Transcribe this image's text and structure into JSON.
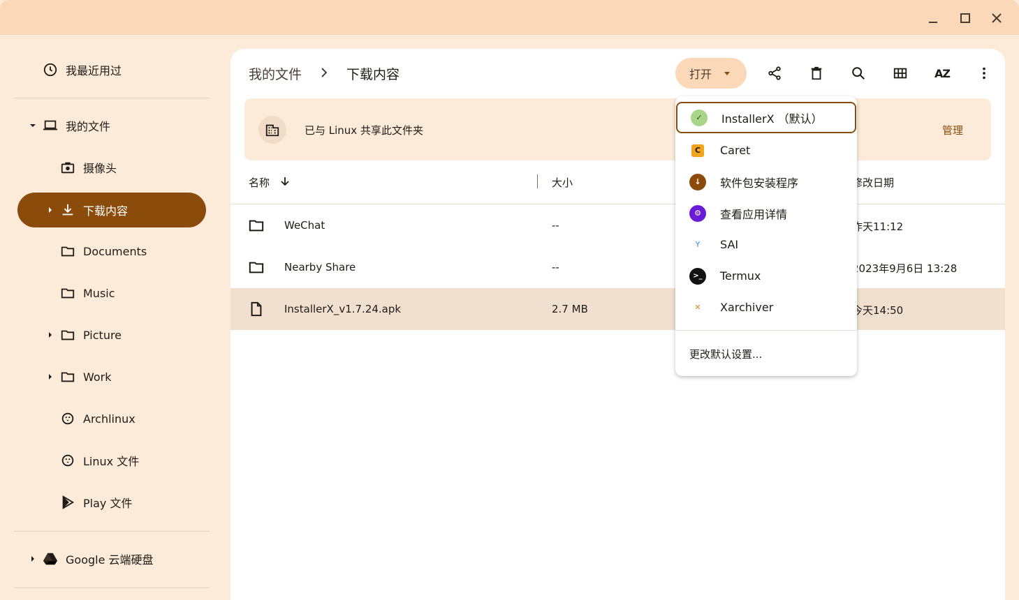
{
  "window": {
    "minimize_icon": "minimize-icon",
    "maximize_icon": "maximize-icon",
    "close_icon": "close-icon"
  },
  "sidebar": {
    "recent": "我最近用过",
    "my_files": "我的文件",
    "items": [
      {
        "label": "摄像头",
        "icon": "camera-icon"
      },
      {
        "label": "下载内容",
        "icon": "download-icon"
      },
      {
        "label": "Documents",
        "icon": "folder-icon"
      },
      {
        "label": "Music",
        "icon": "folder-icon"
      },
      {
        "label": "Picture",
        "icon": "folder-icon"
      },
      {
        "label": "Work",
        "icon": "folder-icon"
      },
      {
        "label": "Archlinux",
        "icon": "penguin-icon"
      },
      {
        "label": "Linux 文件",
        "icon": "penguin-icon"
      },
      {
        "label": "Play 文件",
        "icon": "play-icon"
      }
    ],
    "drive": "Google 云端硬盘"
  },
  "breadcrumb": {
    "root": "我的文件",
    "current": "下载内容"
  },
  "toolbar": {
    "open_label": "打开",
    "sort_label": "AZ"
  },
  "banner": {
    "text": "已与 Linux 共享此文件夹",
    "manage": "管理"
  },
  "columns": {
    "name": "名称",
    "size": "大小",
    "modified": "修改日期"
  },
  "files": [
    {
      "name": "WeChat",
      "size": "--",
      "date": "昨天11:12",
      "type": "folder"
    },
    {
      "name": "Nearby Share",
      "size": "--",
      "date": "2023年9月6日 13:28",
      "type": "folder"
    },
    {
      "name": "InstallerX_v1.7.24.apk",
      "size": "2.7 MB",
      "date": "今天14:50",
      "type": "file"
    }
  ],
  "open_menu": {
    "apps": [
      {
        "label": "InstallerX （默认）",
        "color": "#a8d58a"
      },
      {
        "label": "Caret",
        "color": "#f2a51a"
      },
      {
        "label": "软件包安装程序",
        "color": "#8b4c0b"
      },
      {
        "label": "查看应用详情",
        "color": "#6a1bd6"
      },
      {
        "label": "SAI",
        "color": "#ffffff"
      },
      {
        "label": "Termux",
        "color": "#111111"
      },
      {
        "label": "Xarchiver",
        "color": "#ffffff"
      }
    ],
    "footer": "更改默认设置..."
  },
  "colors": {
    "accent": "#8b4c0b",
    "titlebar": "#fbd9b8",
    "background": "#fdebd9"
  }
}
